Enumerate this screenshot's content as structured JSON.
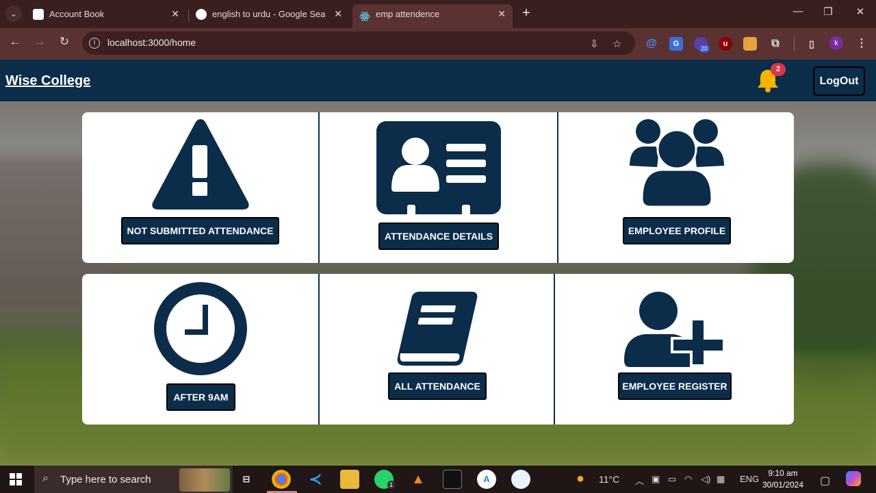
{
  "browser": {
    "tabs": [
      {
        "title": "Account Book",
        "active": false
      },
      {
        "title": "english to urdu - Google Search",
        "active": false
      },
      {
        "title": "emp attendence",
        "active": true
      }
    ],
    "url": "localhost:3000/home",
    "extension_badge": "20",
    "profile_initial": "k"
  },
  "app": {
    "brand": "Wise College",
    "notification_count": "2",
    "logout_label": "LogOut",
    "colors": {
      "primary": "#0b2d4a",
      "bell": "#f5b400",
      "badge": "#dc3545"
    },
    "cards_row1": [
      {
        "icon": "warning-triangle-icon",
        "label": "NOT SUBMITTED ATTENDANCE"
      },
      {
        "icon": "id-card-icon",
        "label": "ATTENDANCE DETAILS"
      },
      {
        "icon": "users-group-icon",
        "label": "EMPLOYEE PROFILE"
      }
    ],
    "cards_row2": [
      {
        "icon": "clock-icon",
        "label": "AFTER 9AM"
      },
      {
        "icon": "book-icon",
        "label": "ALL ATTENDANCE"
      },
      {
        "icon": "user-plus-icon",
        "label": "EMPLOYEE REGISTER"
      }
    ]
  },
  "taskbar": {
    "search_placeholder": "Type here to search",
    "whatsapp_badge": "1",
    "weather": "11°C",
    "language": "ENG",
    "time": "9:10 am",
    "date": "30/01/2024"
  }
}
